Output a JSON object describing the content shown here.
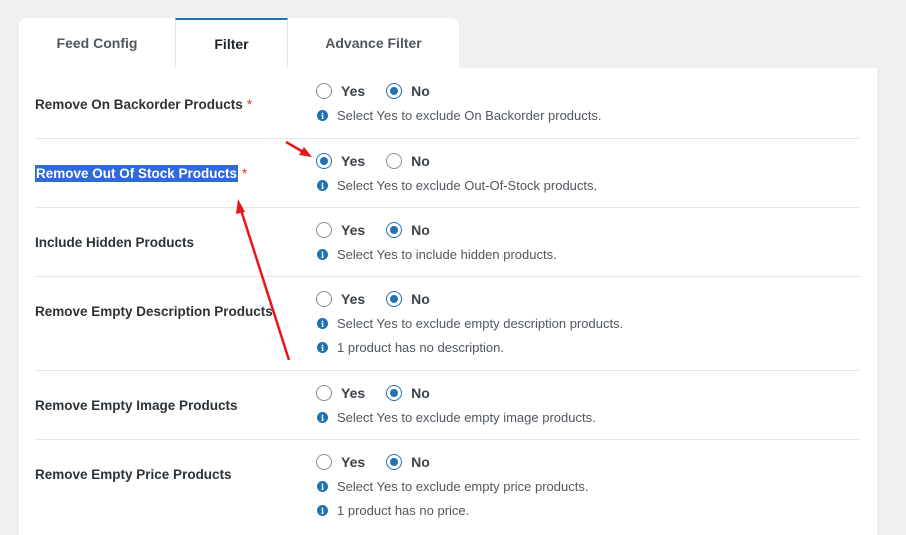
{
  "tabs": [
    {
      "label": "Feed Config",
      "active": false
    },
    {
      "label": "Filter",
      "active": true
    },
    {
      "label": "Advance Filter",
      "active": false
    }
  ],
  "options": {
    "yes": "Yes",
    "no": "No"
  },
  "rows": [
    {
      "label": "Remove On Backorder Products",
      "required": "*",
      "selected": "No",
      "hints": [
        "Select Yes to exclude On Backorder products."
      ]
    },
    {
      "label": "Remove Out Of Stock Products",
      "required": "*",
      "selected": "Yes",
      "highlighted": true,
      "hints": [
        "Select Yes to exclude Out-Of-Stock products."
      ]
    },
    {
      "label": "Include Hidden Products",
      "required": "",
      "selected": "No",
      "hints": [
        "Select Yes to include hidden products."
      ]
    },
    {
      "label": "Remove Empty Description Products",
      "required": "",
      "selected": "No",
      "hints": [
        "Select Yes to exclude empty description products.",
        "1 product has no description."
      ]
    },
    {
      "label": "Remove Empty Image Products",
      "required": "",
      "selected": "No",
      "hints": [
        "Select Yes to exclude empty image products."
      ]
    },
    {
      "label": "Remove Empty Price Products",
      "required": "",
      "selected": "No",
      "hints": [
        "Select Yes to exclude empty price products.",
        "1 product has no price."
      ]
    }
  ],
  "colors": {
    "accent": "#2271b1",
    "annotation_arrow": "#e8161b",
    "highlight": "#2f6bd8"
  },
  "icons": {
    "hint": "info-icon"
  }
}
